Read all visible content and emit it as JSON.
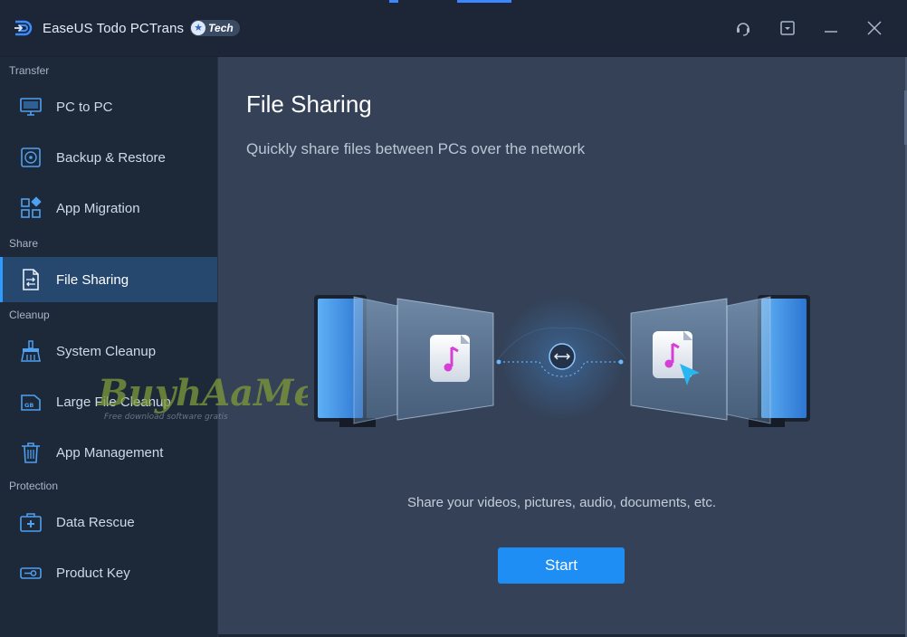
{
  "app": {
    "title": "EaseUS Todo PCTrans",
    "badge": "Tech"
  },
  "window_buttons": [
    "support-icon",
    "menu-icon",
    "minimize-icon",
    "close-icon"
  ],
  "sidebar": {
    "sections": [
      {
        "label": "Transfer"
      },
      {
        "label": "Share"
      },
      {
        "label": "Cleanup"
      },
      {
        "label": "Protection"
      }
    ],
    "items": [
      {
        "label": "PC to PC",
        "icon": "monitor-icon"
      },
      {
        "label": "Backup & Restore",
        "icon": "disk-backup-icon"
      },
      {
        "label": "App Migration",
        "icon": "app-grid-icon"
      },
      {
        "label": "File Sharing",
        "icon": "file-share-icon",
        "active": true
      },
      {
        "label": "System Cleanup",
        "icon": "broom-icon"
      },
      {
        "label": "Large File Cleanup",
        "icon": "gb-drive-icon"
      },
      {
        "label": "App Management",
        "icon": "trash-icon"
      },
      {
        "label": "Data Rescue",
        "icon": "rescue-kit-icon"
      },
      {
        "label": "Product Key",
        "icon": "key-icon"
      }
    ]
  },
  "main": {
    "title": "File Sharing",
    "subtitle": "Quickly share files between PCs over the network",
    "description": "Share your videos, pictures, audio, documents, etc.",
    "start_label": "Start"
  },
  "watermark": {
    "text": "BuyhAaMe",
    "tagline": "Free download software gratis"
  },
  "colors": {
    "accent": "#1e8ef5",
    "active_item": "#26486f",
    "panel": "#344156",
    "sidebar": "#1d2839"
  }
}
